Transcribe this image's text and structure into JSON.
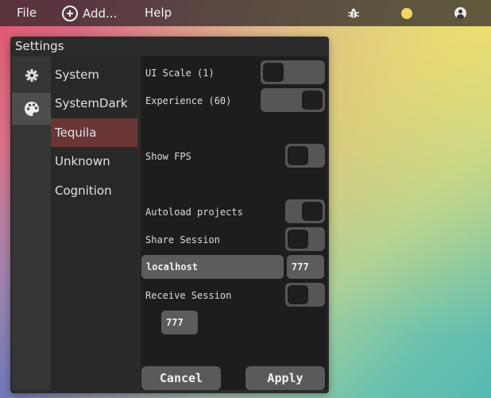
{
  "menubar": {
    "file": "File",
    "add": "Add...",
    "help": "Help",
    "icons": [
      "plus-circle-icon",
      "bug-icon",
      "status-dot-icon",
      "user-icon"
    ],
    "status_dot_color": "#f3d266"
  },
  "window": {
    "title": "Settings",
    "sidebar_icons": [
      "gear-icon",
      "palette-icon"
    ],
    "themes": [
      {
        "label": "System",
        "active": false
      },
      {
        "label": "SystemDark",
        "active": false
      },
      {
        "label": "Tequila",
        "active": true
      },
      {
        "label": "Unknown",
        "active": false
      },
      {
        "label": "Cognition",
        "active": false
      }
    ],
    "settings": {
      "ui_scale_label": "UI Scale (1)",
      "ui_scale_value": 0,
      "experience_label": "Experience (60)",
      "experience_value": 1,
      "show_fps_label": "Show FPS",
      "show_fps_on": false,
      "autoload_label": "Autoload projects",
      "autoload_on": true,
      "share_session_label": "Share Session",
      "share_session_on": false,
      "host_value": "localhost",
      "port_value": "777",
      "receive_session_label": "Receive Session",
      "receive_session_on": false,
      "receive_port_value": "777"
    },
    "buttons": {
      "cancel": "Cancel",
      "apply": "Apply"
    }
  },
  "colors": {
    "active_theme": "#6a3535",
    "panel_bg": "#1d1d1d"
  }
}
